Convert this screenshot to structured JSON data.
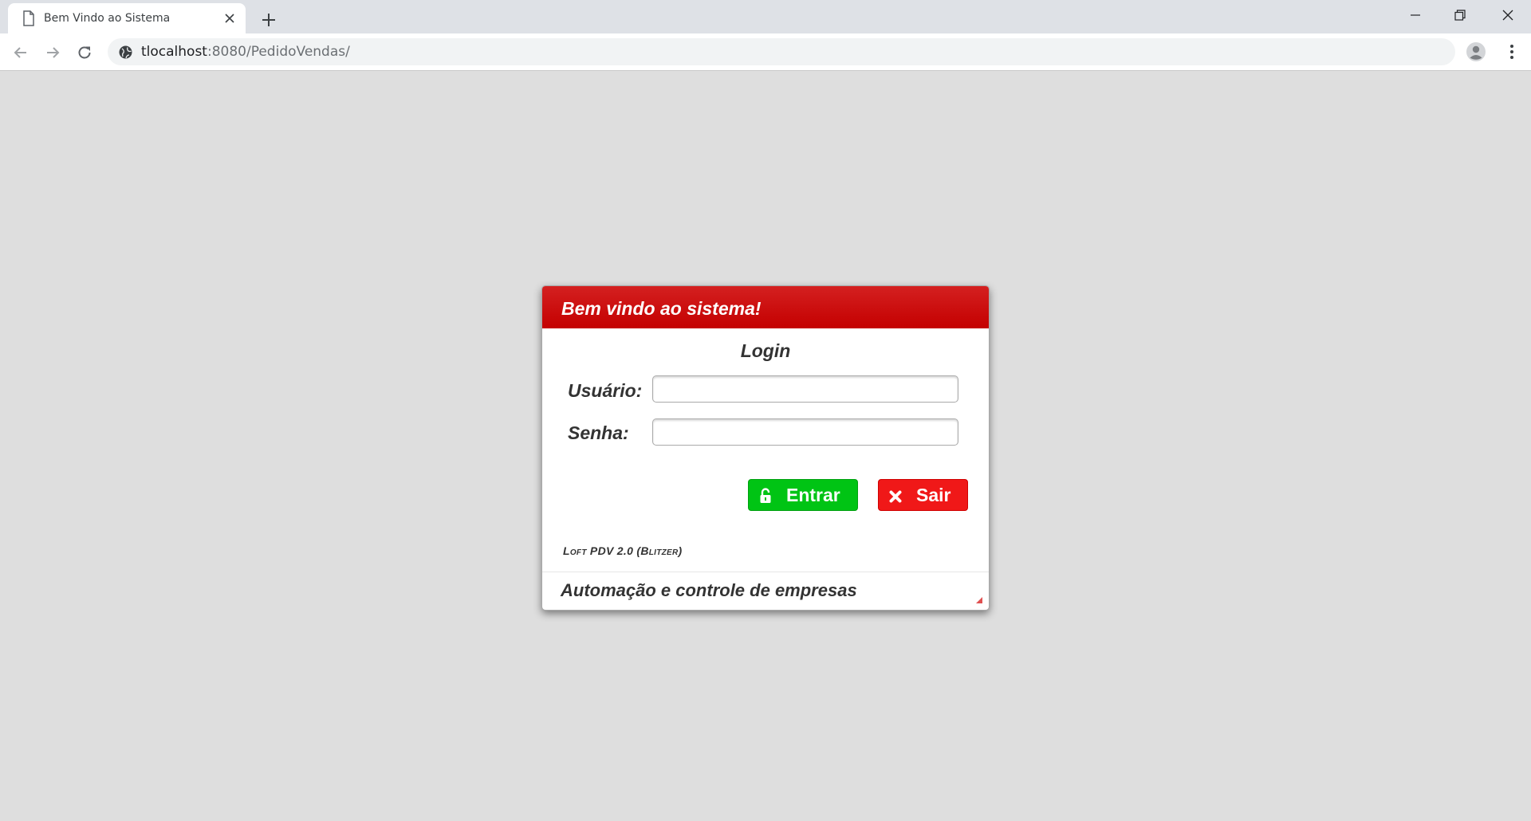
{
  "browser": {
    "tab_title": "Bem Vindo ao Sistema",
    "url_host": "tlocalhost",
    "url_rest": ":8080/PedidoVendas/"
  },
  "dialog": {
    "title": "Bem vindo ao sistema!",
    "heading": "Login",
    "user_label": "Usuário:",
    "user_value": "",
    "password_label": "Senha:",
    "password_value": "",
    "enter_button": "Entrar",
    "exit_button": "Sair",
    "version": "Loft PDV 2.0 (Blitzer)",
    "footer": "Automação e controle de empresas"
  },
  "colors": {
    "header_red": "#c40000",
    "enter_green": "#00c414",
    "exit_red": "#f01818",
    "page_background": "#dedede"
  },
  "icons": {
    "tab": "page-icon",
    "enter_button": "unlock-icon",
    "exit_button": "x-icon",
    "address_bar": "globe-icon"
  }
}
